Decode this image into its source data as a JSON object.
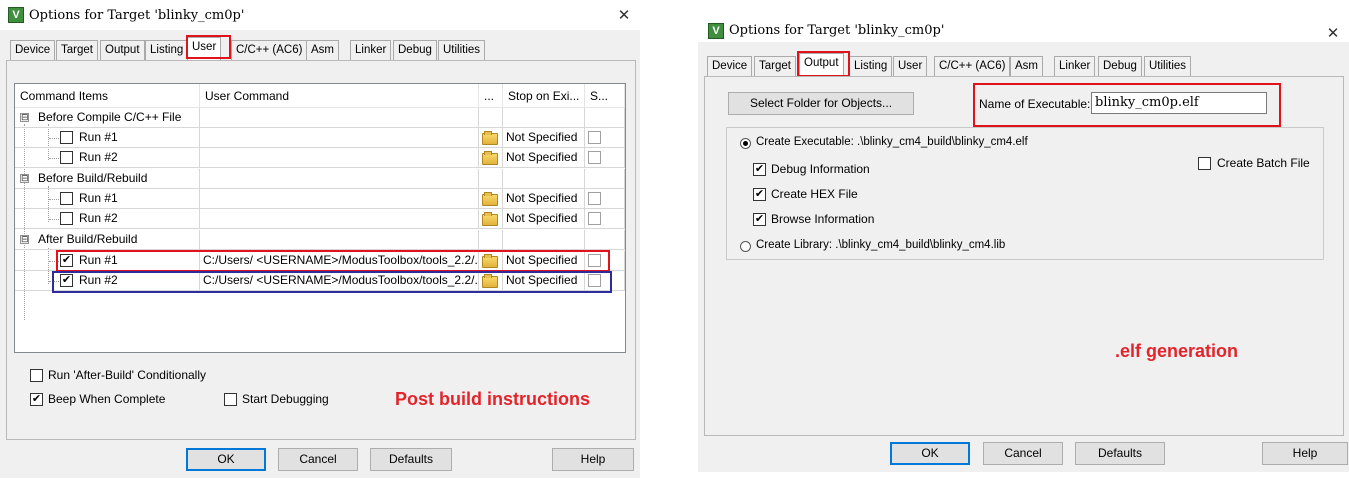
{
  "dialog1": {
    "title": "Options for Target 'blinky_cm0p'",
    "tabs": [
      "Device",
      "Target",
      "Output",
      "Listing",
      "User",
      "C/C++ (AC6)",
      "Asm",
      "Linker",
      "Debug",
      "Utilities"
    ],
    "active_tab": "User",
    "columns": [
      "Command Items",
      "User Command",
      "...",
      "Stop on Exi...",
      "S..."
    ],
    "groups": [
      {
        "label": "Before Compile C/C++ File",
        "expander": "⊟",
        "rows": [
          {
            "label": "Run #1",
            "checked": false,
            "command": "",
            "stop": "Not Specified"
          },
          {
            "label": "Run #2",
            "checked": false,
            "command": "",
            "stop": "Not Specified"
          }
        ]
      },
      {
        "label": "Before Build/Rebuild",
        "expander": "⊟",
        "rows": [
          {
            "label": "Run #1",
            "checked": false,
            "command": "",
            "stop": "Not Specified"
          },
          {
            "label": "Run #2",
            "checked": false,
            "command": "",
            "stop": "Not Specified"
          }
        ]
      },
      {
        "label": "After Build/Rebuild",
        "expander": "⊟",
        "rows": [
          {
            "label": "Run #1",
            "checked": true,
            "command": "C:/Users/ <USERNAME>/ModusToolbox/tools_2.2/...",
            "stop": "Not Specified"
          },
          {
            "label": "Run #2",
            "checked": true,
            "command": "C:/Users/ <USERNAME>/ModusToolbox/tools_2.2/...",
            "stop": "Not Specified"
          }
        ]
      }
    ],
    "options": {
      "run_after_build": "Run 'After-Build' Conditionally",
      "beep": "Beep When Complete",
      "start_debugging": "Start Debugging"
    },
    "annotation": "Post build instructions",
    "buttons": {
      "ok": "OK",
      "cancel": "Cancel",
      "defaults": "Defaults",
      "help": "Help"
    },
    "check_mark": "✔",
    "close_glyph": "✕"
  },
  "dialog2": {
    "title": "Options for Target 'blinky_cm0p'",
    "tabs": [
      "Device",
      "Target",
      "Output",
      "Listing",
      "User",
      "C/C++ (AC6)",
      "Asm",
      "Linker",
      "Debug",
      "Utilities"
    ],
    "active_tab": "Output",
    "select_folder_label": "Select Folder for Objects...",
    "name_of_executable_label": "Name of Executable:",
    "name_of_executable_value": "blinky_cm0p.elf",
    "create_executable_label": "Create Executable:  .\\blinky_cm4_build\\blinky_cm4.elf",
    "debug_information": "Debug Information",
    "create_hex": "Create HEX File",
    "browse_information": "Browse Information",
    "create_batch": "Create Batch File",
    "create_library_label": "Create Library:  .\\blinky_cm4_build\\blinky_cm4.lib",
    "annotation": ".elf generation",
    "buttons": {
      "ok": "OK",
      "cancel": "Cancel",
      "defaults": "Defaults",
      "help": "Help"
    },
    "check_mark": "✔",
    "close_glyph": "✕"
  },
  "colors": {
    "annotation_red": "#e3242b",
    "highlight_red": "#e0131d",
    "highlight_blue": "#2c2c9c"
  },
  "icons": {
    "app": "keil-uvision-icon",
    "folder": "folder-icon"
  }
}
